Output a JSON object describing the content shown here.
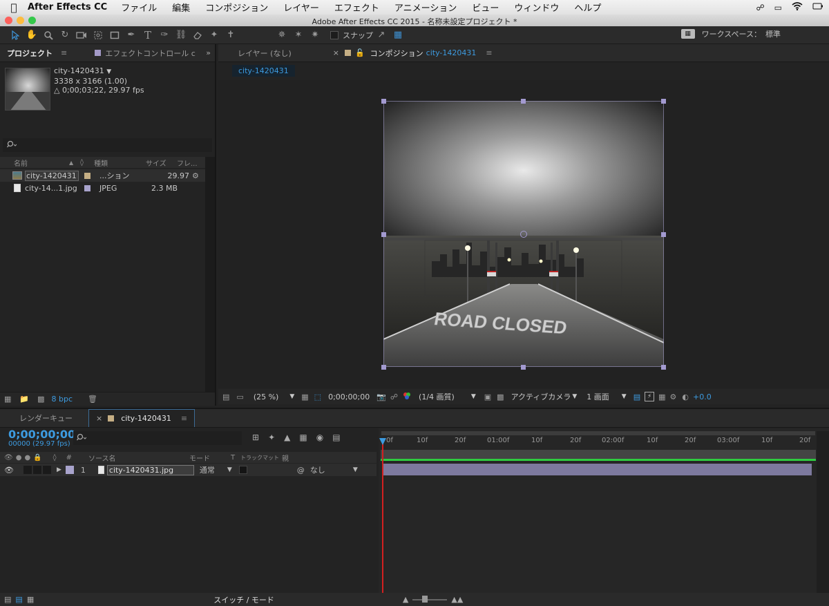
{
  "menubar": {
    "app_name": "After Effects CC",
    "items": [
      "ファイル",
      "編集",
      "コンポジション",
      "レイヤー",
      "エフェクト",
      "アニメーション",
      "ビュー",
      "ウィンドウ",
      "ヘルプ"
    ]
  },
  "window": {
    "title": "Adobe After Effects CC 2015 - 名称未設定プロジェクト *"
  },
  "toolbar": {
    "snap_label": "スナップ",
    "workspace_label": "ワークスペース：",
    "workspace_value": "標準"
  },
  "project_panel": {
    "tab_project": "プロジェクト",
    "tab_effects": "エフェクトコントロール c",
    "selected": {
      "name": "city-1420431",
      "dims": "3338 x 3166 (1.00)",
      "duration": "△ 0;00;03;22, 29.97 fps"
    },
    "search_placeholder": "",
    "columns": {
      "name": "名前",
      "type": "種類",
      "size": "サイズ",
      "frame": "フレ..."
    },
    "items": [
      {
        "name": "city-1420431",
        "type": "...ション",
        "size": "",
        "frame": "29.97"
      },
      {
        "name": "city-14...1.jpg",
        "type": "JPEG",
        "size": "2.3 MB",
        "frame": ""
      }
    ],
    "bpc": "8 bpc"
  },
  "comp_panel": {
    "tab_layer": "レイヤー (なし)",
    "tab_comp_prefix": "コンポジション",
    "tab_comp_name": "city-1420431",
    "breadcrumb": "city-1420431",
    "image_text": "ROAD CLOSED",
    "footer": {
      "zoom": "(25 %)",
      "timecode": "0;00;00;00",
      "resolution": "(1/4 画質)",
      "camera": "アクティブカメラ",
      "views": "1 画面",
      "exposure": "+0.0"
    }
  },
  "timeline": {
    "tab_render": "レンダーキュー",
    "tab_comp": "city-1420431",
    "timecode": "0;00;00;00",
    "frames": "00000 (29.97 fps)",
    "columns": {
      "num": "#",
      "source": "ソース名",
      "mode": "モード",
      "t": "T",
      "trkmat": "トラックマット",
      "parent": "親"
    },
    "layer": {
      "num": "1",
      "name": "city-1420431.jpg",
      "mode": "通常",
      "parent": "なし"
    },
    "ruler": [
      "0f",
      "10f",
      "20f",
      "01:00f",
      "10f",
      "20f",
      "02:00f",
      "10f",
      "20f",
      "03:00f",
      "10f",
      "20f"
    ],
    "footer_label": "スイッチ / モード"
  },
  "colors": {
    "accent": "#3d9be0",
    "layer_bar": "#8d88b4",
    "work_area": "#2ecc40",
    "playhead": "#d42020"
  }
}
